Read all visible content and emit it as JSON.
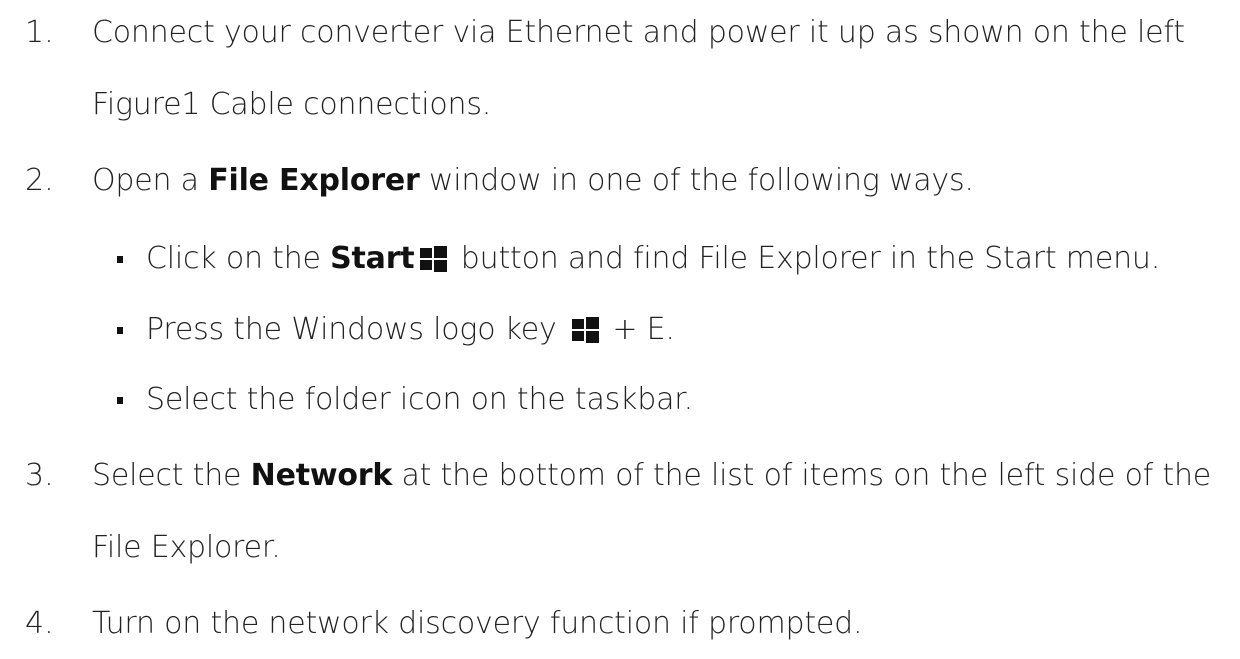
{
  "steps": [
    {
      "number": "1.",
      "line1": "Connect your converter via Ethernet and power it up as shown on the left",
      "line2": "Figure1 Cable connections."
    },
    {
      "number": "2.",
      "prefix": "Open a ",
      "bold": "File Explorer",
      "suffix": " window in one of the following ways.",
      "bullets": [
        {
          "prefix": "Click on the ",
          "bold": "Start",
          "icon": "windows-logo-icon",
          "suffix": "button and find File Explorer in the Start menu."
        },
        {
          "prefix": "Press the Windows logo key",
          "icon": "windows-logo-icon",
          "suffix": "+ E."
        },
        {
          "text": "Select the folder icon on the taskbar."
        }
      ]
    },
    {
      "number": "3.",
      "prefix": "Select the ",
      "bold": "Network",
      "suffix": " at the bottom of the list of items on the left side of the",
      "line2": "File Explorer."
    },
    {
      "number": "4.",
      "text": "Turn on the network discovery function if prompted."
    }
  ],
  "colors": {
    "text": "#222222",
    "bold_text": "#111111",
    "background": "#ffffff"
  }
}
